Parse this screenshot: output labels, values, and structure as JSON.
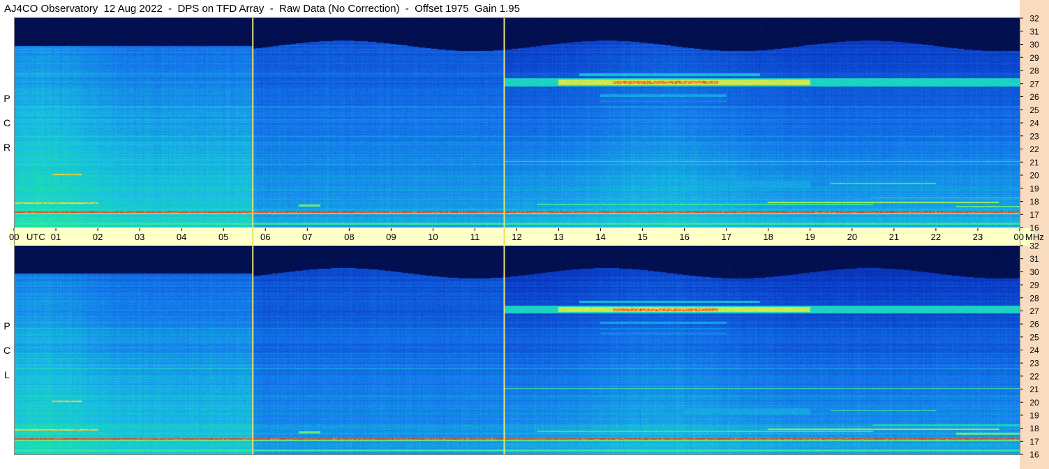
{
  "title": "AJ4CO Observatory  12 Aug 2022  -  DPS on TFD Array  -  Raw Data (No Correction)  -  Offset 1975  Gain 1.95",
  "colors": {
    "background_dark": "#000a2a",
    "deep_blue": "#0a2ea8",
    "mid_blue": "#1a6ee6",
    "cyan": "#18c8e0",
    "green": "#22e8a0",
    "yellow": "#f6f060",
    "red": "#e83020",
    "marker_line": "#e8e070",
    "utc_band": "#ffffc8",
    "freq_strip": "#f9dcc0"
  },
  "chart_data": {
    "type": "heatmap",
    "panels": [
      {
        "id": "rcp",
        "label": [
          "R",
          "C",
          "P"
        ],
        "polarization": "RCP"
      },
      {
        "id": "lcp",
        "label": [
          "L",
          "C",
          "P"
        ],
        "polarization": "LCP"
      }
    ],
    "x_axis": {
      "quantity": "UTC hour",
      "range": [
        0,
        24
      ],
      "tick_labels": [
        "00",
        "01",
        "02",
        "03",
        "04",
        "05",
        "06",
        "07",
        "08",
        "09",
        "10",
        "11",
        "12",
        "13",
        "14",
        "15",
        "16",
        "17",
        "18",
        "19",
        "20",
        "21",
        "22",
        "23",
        "00"
      ],
      "unit_label": "UTC"
    },
    "y_axis": {
      "quantity": "Frequency",
      "range": [
        16,
        32
      ],
      "tick_labels": [
        "32",
        "31",
        "30",
        "29",
        "28",
        "27",
        "26",
        "25",
        "24",
        "23",
        "22",
        "21",
        "20",
        "19",
        "18",
        "17",
        "16"
      ],
      "unit_label": "MHz"
    },
    "marker_times_utc": [
      5.7,
      11.7
    ],
    "noise_floor_cutoff_mhz": 29.9,
    "activity_segments": [
      {
        "t0": 11.7,
        "t1": 24.0,
        "f0": 26.8,
        "f1": 27.4,
        "level": 0.62
      },
      {
        "t0": 13.0,
        "t1": 19.0,
        "f0": 26.9,
        "f1": 27.3,
        "level": 0.85
      },
      {
        "t0": 14.3,
        "t1": 16.8,
        "f0": 27.0,
        "f1": 27.2,
        "level": 0.95
      },
      {
        "t0": 13.5,
        "t1": 17.8,
        "f0": 27.6,
        "f1": 27.8,
        "level": 0.55
      },
      {
        "t0": 14.0,
        "t1": 17.0,
        "f0": 26.0,
        "f1": 26.2,
        "level": 0.5
      },
      {
        "t0": 14.0,
        "t1": 17.0,
        "f0": 25.6,
        "f1": 25.7,
        "level": 0.45
      },
      {
        "t0": 14.0,
        "t1": 17.0,
        "f0": 25.2,
        "f1": 25.3,
        "level": 0.45
      },
      {
        "t0": 0.0,
        "t1": 5.7,
        "f0": 27.0,
        "f1": 27.1,
        "level": 0.45
      },
      {
        "t0": 0.0,
        "t1": 24.0,
        "f0": 17.0,
        "f1": 17.15,
        "level": 0.75
      },
      {
        "t0": 0.0,
        "t1": 24.0,
        "f0": 17.1,
        "f1": 17.2,
        "level": 1.0
      },
      {
        "t0": 0.0,
        "t1": 24.0,
        "f0": 16.2,
        "f1": 16.35,
        "level": 0.7
      },
      {
        "t0": 0.0,
        "t1": 2.0,
        "f0": 17.8,
        "f1": 17.9,
        "level": 0.9
      },
      {
        "t0": 0.9,
        "t1": 1.6,
        "f0": 20.0,
        "f1": 20.1,
        "level": 0.9
      },
      {
        "t0": 11.7,
        "t1": 24.0,
        "f0": 21.0,
        "f1": 21.08,
        "level": 0.7
      },
      {
        "t0": 12.5,
        "t1": 20.5,
        "f0": 17.7,
        "f1": 17.8,
        "level": 0.7
      },
      {
        "t0": 18.0,
        "t1": 23.5,
        "f0": 17.85,
        "f1": 17.95,
        "level": 0.8
      },
      {
        "t0": 6.8,
        "t1": 7.3,
        "f0": 17.6,
        "f1": 17.72,
        "level": 0.75
      },
      {
        "t0": 19.5,
        "t1": 22.0,
        "f0": 19.3,
        "f1": 19.38,
        "level": 0.7
      },
      {
        "t0": 20.5,
        "t1": 24.0,
        "f0": 18.2,
        "f1": 18.28,
        "level": 0.65
      },
      {
        "t0": 16.0,
        "t1": 19.0,
        "f0": 19.0,
        "f1": 19.5,
        "level": 0.5
      },
      {
        "t0": 22.5,
        "t1": 24.0,
        "f0": 17.5,
        "f1": 17.65,
        "level": 0.75
      }
    ]
  }
}
